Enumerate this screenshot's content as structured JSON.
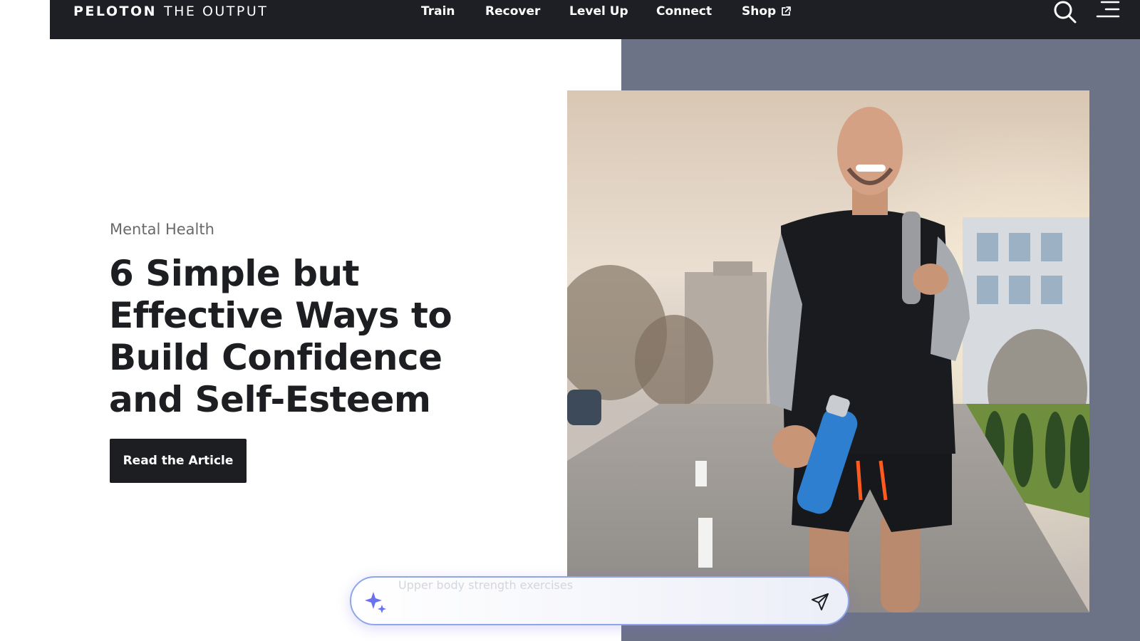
{
  "header": {
    "brand_strong": "PELOTON",
    "brand_light": "THE OUTPUT",
    "nav": [
      {
        "label": "Train"
      },
      {
        "label": "Recover"
      },
      {
        "label": "Level Up"
      },
      {
        "label": "Connect"
      },
      {
        "label": "Shop",
        "icon": "external-link-icon"
      }
    ],
    "icons": [
      "search-icon",
      "menu-icon"
    ]
  },
  "hero": {
    "category": "Mental Health",
    "title": "6 Simple but Effective Ways to Build Confidence and Self-Esteem",
    "cta_label": "Read the Article",
    "image_icon": "runner-photo"
  },
  "ai_search": {
    "placeholder": "Upper body strength exercises",
    "left_icon": "sparkle-icon",
    "right_icon": "send-icon"
  },
  "colors": {
    "nav_bg": "#1e1f24",
    "panel_bg": "#6d7387",
    "text_dark": "#1d1e22",
    "category_gray": "#6a6a6a",
    "accent_purple": "#7b68ee"
  }
}
